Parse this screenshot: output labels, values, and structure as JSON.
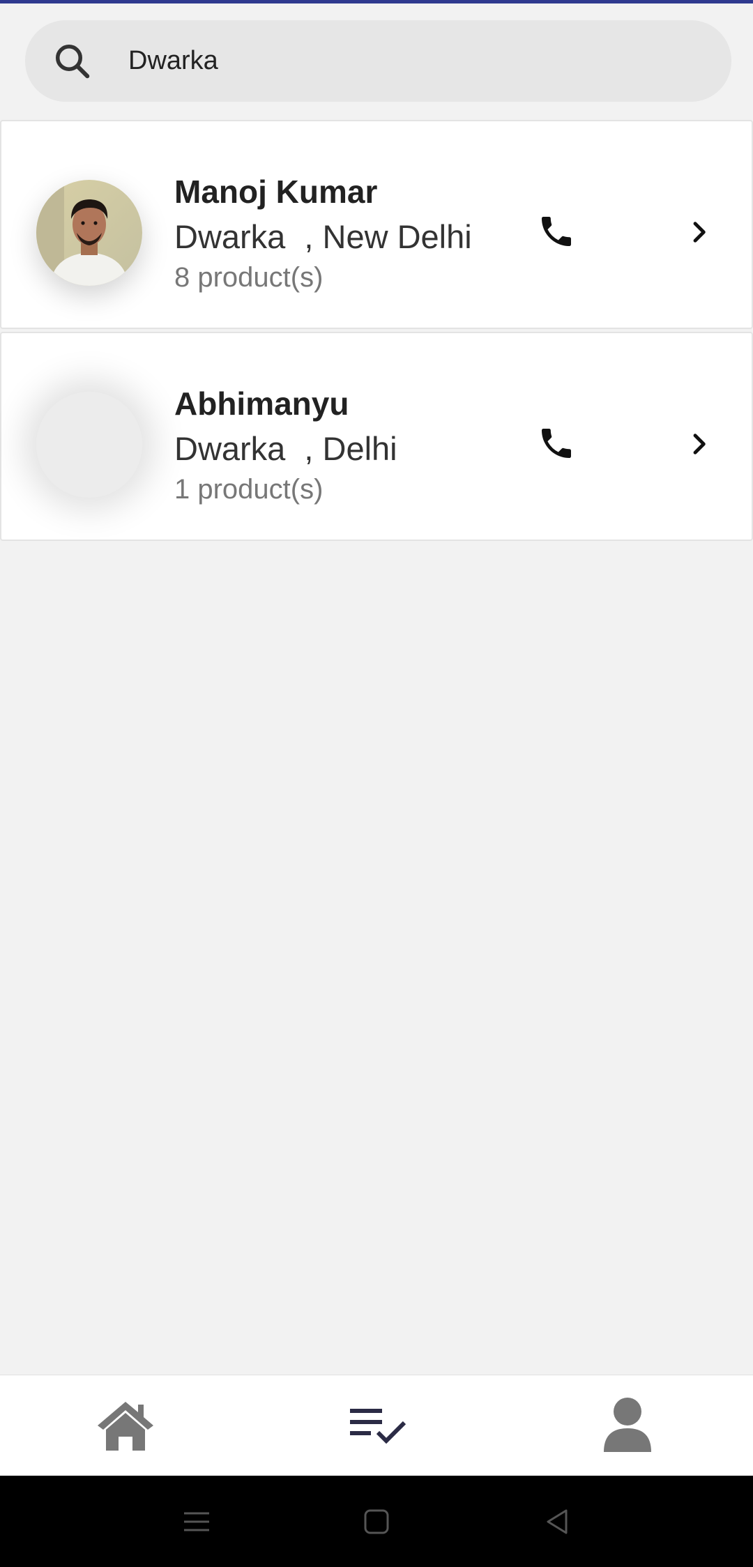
{
  "search": {
    "value": "Dwarka",
    "icon": "search-icon"
  },
  "results": [
    {
      "name": "Manoj Kumar",
      "area": "Dwarka",
      "city": "New Delhi",
      "products": "8 product(s)",
      "has_photo": true
    },
    {
      "name": "Abhimanyu",
      "area": "Dwarka",
      "city": "Delhi",
      "products": "1 product(s)",
      "has_photo": false
    }
  ],
  "bottom_nav": {
    "items": [
      "home-icon",
      "orders-checklist-icon",
      "profile-icon"
    ],
    "active": "orders-checklist-icon"
  },
  "colors": {
    "top_accent": "#2f3a8f",
    "background": "#f2f2f2",
    "nav_icon": "#777777",
    "nav_icon_active": "#2b2b45"
  }
}
